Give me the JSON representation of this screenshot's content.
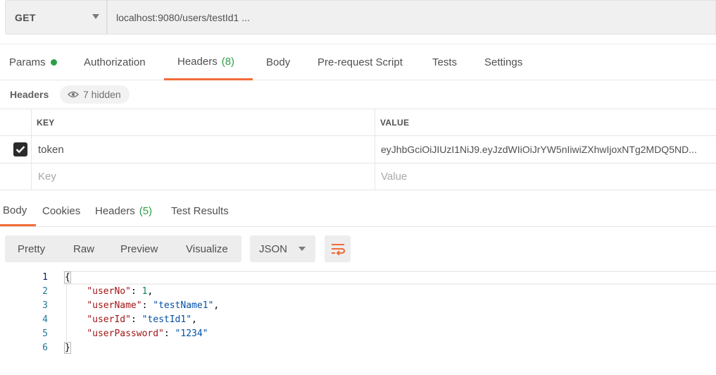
{
  "request": {
    "method": "GET",
    "url": "localhost:9080/users/testId1 ..."
  },
  "request_tabs": [
    {
      "label": "Params",
      "has_dot": true
    },
    {
      "label": "Authorization"
    },
    {
      "label": "Headers",
      "count": "(8)",
      "active": true
    },
    {
      "label": "Body"
    },
    {
      "label": "Pre-request Script"
    },
    {
      "label": "Tests"
    },
    {
      "label": "Settings"
    }
  ],
  "headers_section": {
    "title": "Headers",
    "hidden_label": "7 hidden"
  },
  "headers_table": {
    "columns": [
      "KEY",
      "VALUE"
    ],
    "rows": [
      {
        "checked": true,
        "key": "token",
        "value": "eyJhbGciOiJIUzI1NiJ9.eyJzdWIiOiJrYW5nIiwiZXhwIjoxNTg2MDQ5ND..."
      }
    ],
    "placeholder_key": "Key",
    "placeholder_value": "Value"
  },
  "response_tabs": [
    {
      "label": "Body",
      "active": true
    },
    {
      "label": "Cookies"
    },
    {
      "label": "Headers",
      "count": "(5)"
    },
    {
      "label": "Test Results"
    }
  ],
  "format_buttons": [
    "Pretty",
    "Raw",
    "Preview",
    "Visualize"
  ],
  "language": "JSON",
  "response_body": {
    "line_numbers": [
      "1",
      "2",
      "3",
      "4",
      "5",
      "6"
    ],
    "open_brace": "{",
    "close_brace": "}",
    "fields": [
      {
        "key": "\"userNo\"",
        "value": "1",
        "type": "number",
        "comma": ","
      },
      {
        "key": "\"userName\"",
        "value": "\"testName1\"",
        "type": "string",
        "comma": ","
      },
      {
        "key": "\"userId\"",
        "value": "\"testId1\"",
        "type": "string",
        "comma": ","
      },
      {
        "key": "\"userPassword\"",
        "value": "\"1234\"",
        "type": "string",
        "comma": ""
      }
    ]
  },
  "colors": {
    "accent": "#f26b3a",
    "green": "#2e9e46",
    "json_key": "#a31515",
    "json_string": "#0451a5",
    "json_number": "#098658"
  }
}
